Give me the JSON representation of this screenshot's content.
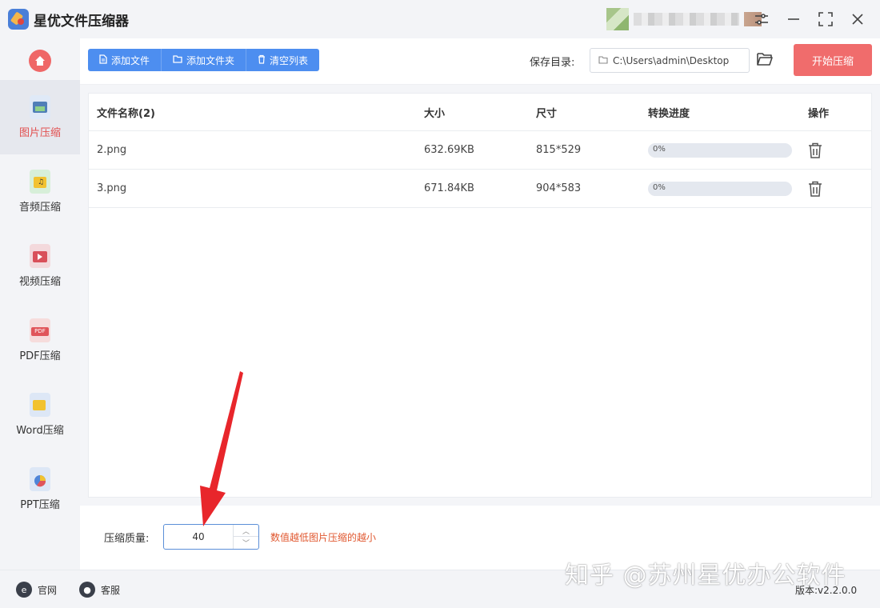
{
  "app": {
    "title": "星优文件压缩器"
  },
  "sidebar": {
    "items": [
      {
        "label": "图片压缩",
        "icon": "image-file-icon",
        "active": true
      },
      {
        "label": "音频压缩",
        "icon": "audio-file-icon",
        "active": false
      },
      {
        "label": "视频压缩",
        "icon": "video-file-icon",
        "active": false
      },
      {
        "label": "PDF压缩",
        "icon": "pdf-file-icon",
        "active": false
      },
      {
        "label": "Word压缩",
        "icon": "word-file-icon",
        "active": false
      },
      {
        "label": "PPT压缩",
        "icon": "ppt-file-icon",
        "active": false
      }
    ]
  },
  "toolbar": {
    "add_file": "添加文件",
    "add_folder": "添加文件夹",
    "clear_list": "清空列表",
    "save_dir_label": "保存目录:",
    "save_dir_path": "C:\\Users\\admin\\Desktop",
    "start_button": "开始压缩"
  },
  "table": {
    "headers": [
      "文件名称(2)",
      "大小",
      "尺寸",
      "转换进度",
      "操作"
    ],
    "rows": [
      {
        "name": "2.png",
        "size": "632.69KB",
        "dimensions": "815*529",
        "progress_text": "0%",
        "progress": 0
      },
      {
        "name": "3.png",
        "size": "671.84KB",
        "dimensions": "904*583",
        "progress_text": "0%",
        "progress": 0
      }
    ]
  },
  "quality": {
    "label": "压缩质量:",
    "value": "40",
    "hint": "数值越低图片压缩的越小"
  },
  "statusbar": {
    "website": "官网",
    "support": "客服",
    "version": "版本:v2.2.0.0"
  },
  "watermark": "知乎 @苏州星优办公软件",
  "colors": {
    "accent_blue": "#4d8ef0",
    "accent_red": "#f06c6c",
    "hint_orange": "#e0572f",
    "arrow_red": "#e8262b"
  }
}
